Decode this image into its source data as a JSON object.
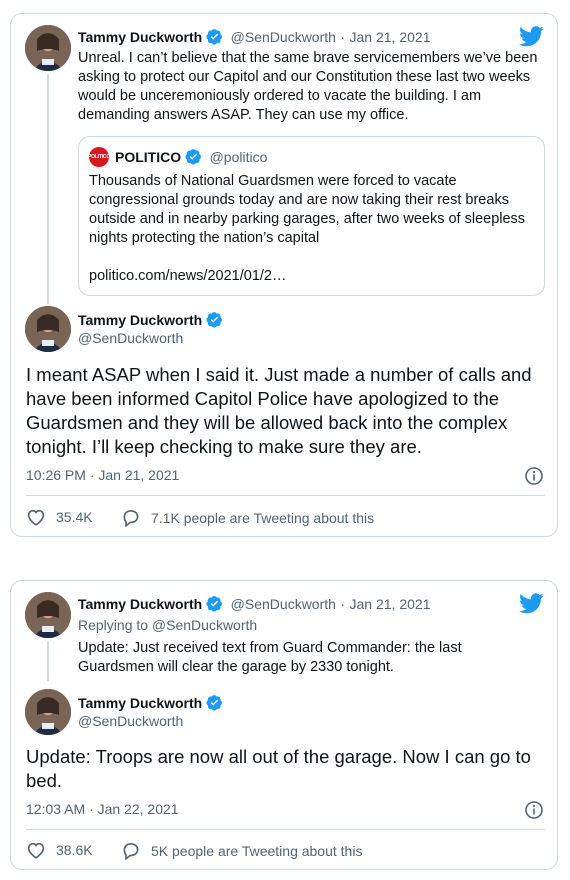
{
  "colors": {
    "twitter_blue": "#1d9bf0",
    "secondary_text": "#536471",
    "border": "#cfd9de",
    "politico_red": "#d7181e"
  },
  "card1": {
    "parent": {
      "name": "Tammy Duckworth",
      "handle": "@SenDuckworth",
      "separator": "·",
      "date": "Jan 21, 2021",
      "text": "Unreal. I can’t believe that the same brave servicemembers we’ve been asking to protect our Capitol and our Constitution these last two weeks would be unceremoniously ordered to vacate the building. I am demanding answers ASAP. They can use my office.",
      "quote": {
        "logo_text": "POLITICO",
        "name": "POLITICO",
        "handle": "@politico",
        "text": "Thousands of National Guardsmen were forced to vacate congressional grounds today and are now taking their rest breaks outside and in nearby parking garages, after two weeks of sleepless nights protecting the nation’s capital",
        "link": "politico.com/news/2021/01/2…"
      }
    },
    "main": {
      "name": "Tammy Duckworth",
      "handle": "@SenDuckworth",
      "text": "I meant ASAP when I said it. Just made a number of calls and have been informed Capitol Police have apologized to the Guardsmen and they will be allowed back into the complex tonight. I’ll keep checking to make sure they are.",
      "timestamp": "10:26 PM · Jan 21, 2021",
      "likes": "35.4K",
      "retweets_label": "7.1K people are Tweeting about this"
    }
  },
  "card2": {
    "parent": {
      "name": "Tammy Duckworth",
      "handle": "@SenDuckworth",
      "separator": "·",
      "date": "Jan 21, 2021",
      "replying_to": "Replying to @SenDuckworth",
      "text": "Update: Just received text from Guard Commander: the last Guardsmen will clear the garage by 2330 tonight."
    },
    "main": {
      "name": "Tammy Duckworth",
      "handle": "@SenDuckworth",
      "text": "Update: Troops are now all out of the garage. Now I can go to bed.",
      "timestamp": "12:03 AM · Jan 22, 2021",
      "likes": "38.6K",
      "retweets_label": "5K people are Tweeting about this"
    }
  },
  "icons": [
    "verified-icon",
    "twitter-bird-icon",
    "info-icon",
    "heart-icon",
    "speech-bubble-icon"
  ]
}
